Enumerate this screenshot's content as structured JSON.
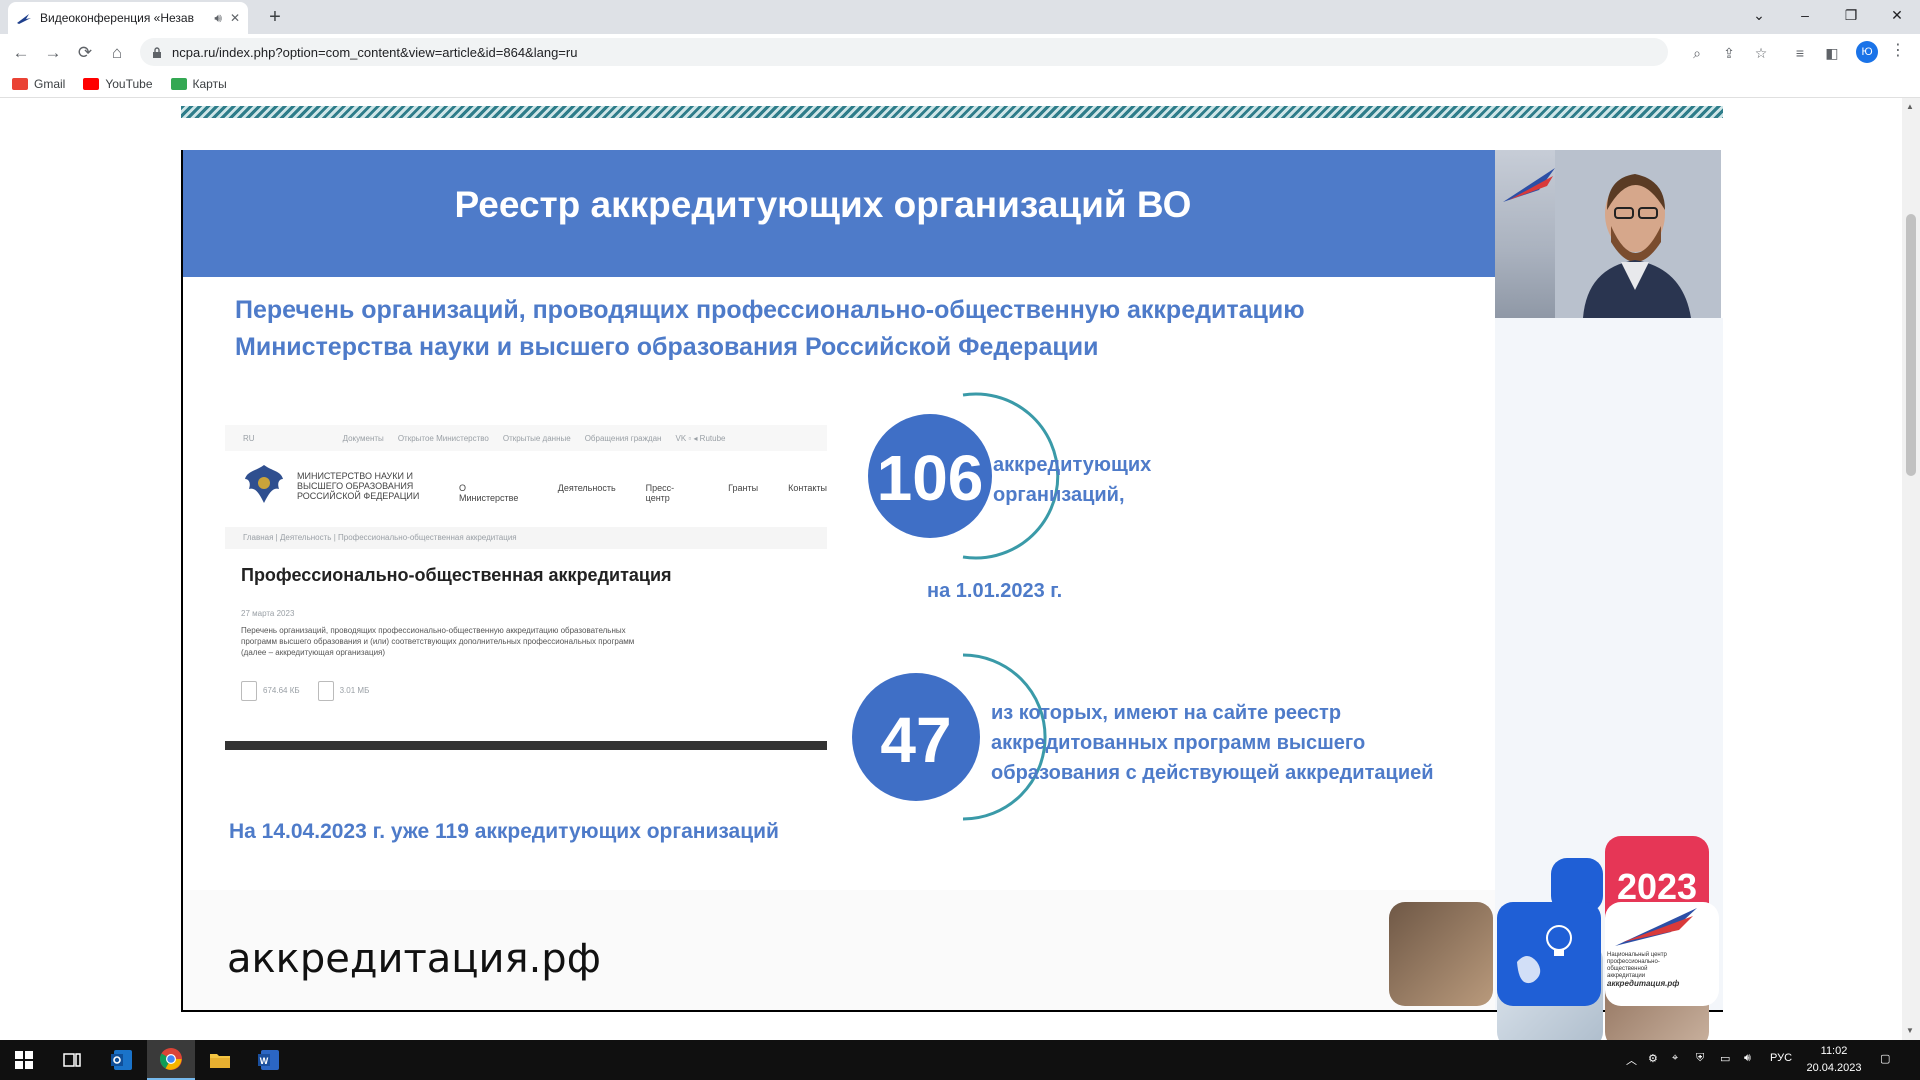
{
  "browser": {
    "tab_title": "Видеоконференция «Незав",
    "new_tab": "+",
    "url": "ncpa.ru/index.php?option=com_content&view=article&id=864&lang=ru",
    "profile_initial": "Ю",
    "bookmarks": [
      {
        "label": "Gmail",
        "color": "#ea4335"
      },
      {
        "label": "YouTube",
        "color": "#ff0000"
      },
      {
        "label": "Карты",
        "color": "#34a853"
      }
    ]
  },
  "slide": {
    "title": "Реестр аккредитующих организаций ВО",
    "subtitle_1": "Перечень организаций, проводящих профессионально-общественную аккредитацию",
    "subtitle_2": "Министерства науки и высшего образования Российской Федерации",
    "mini_site": {
      "lang": "RU",
      "top_links": [
        "Документы",
        "Открытое Министерство",
        "Открытые данные",
        "Обращения граждан"
      ],
      "social": "VK ▫ ◂ Rutube",
      "org_name": "МИНИСТЕРСТВО НАУКИ И ВЫСШЕГО ОБРАЗОВАНИЯ РОССИЙСКОЙ ФЕДЕРАЦИИ",
      "nav": [
        "О Министерстве",
        "Деятельность",
        "Пресс-центр",
        "Гранты",
        "Контакты"
      ],
      "breadcrumbs": "Главная   |   Деятельность   |   Профессионально-общественная аккредитация",
      "heading": "Профессионально-общественная аккредитация",
      "date": "27 марта 2023",
      "text": "Перечень организаций, проводящих профессионально-общественную аккредитацию образовательных программ высшего образования и (или) соответствующих дополнительных профессиональных программ (далее – аккредитующая организация)",
      "file_1": "674.64 КБ",
      "file_2": "3.01 МБ"
    },
    "stat_1": {
      "number": "106",
      "label_1": "аккредитующих",
      "label_2": "организаций,",
      "date": "на 1.01.2023 г."
    },
    "stat_2": {
      "number": "47",
      "label_1": "из которых, имеют на сайте реестр",
      "label_2": "аккредитованных программ высшего",
      "label_3": "образования с действующей аккредитацией"
    },
    "note": "На 14.04.2023 г. уже 119 аккредитующих организаций",
    "site": "аккредитация.рф",
    "year": "2023",
    "logo_caption": "Национальный центр профессионально-общественной аккредитации",
    "logo_site": "аккредитация.рф"
  },
  "taskbar": {
    "lang": "РУС",
    "time": "11:02",
    "date": "20.04.2023"
  },
  "colors": {
    "slide_blue": "#4e7bc9",
    "circle_dark": "#3f6fc6",
    "arc_teal": "#3a9aa8",
    "year_pink": "#e63656"
  }
}
